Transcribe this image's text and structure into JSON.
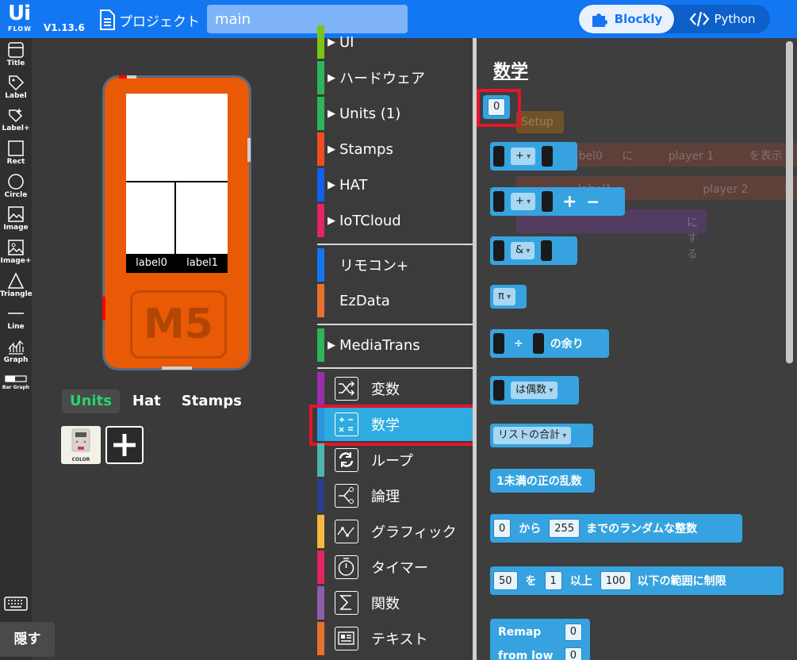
{
  "header": {
    "logo_text": "Ui",
    "logo_sub": "FLOW",
    "version": "V1.13.6",
    "project_label": "プロジェクト",
    "filename": "main",
    "mode_blockly": "Blockly",
    "mode_python": "Python"
  },
  "tools": [
    {
      "label": "Title",
      "icon": "title-icon"
    },
    {
      "label": "Label",
      "icon": "label-icon"
    },
    {
      "label": "Label+",
      "icon": "label-plus-icon"
    },
    {
      "label": "Rect",
      "icon": "rect-icon"
    },
    {
      "label": "Circle",
      "icon": "circle-icon"
    },
    {
      "label": "Image",
      "icon": "image-icon"
    },
    {
      "label": "Image+",
      "icon": "image-plus-icon"
    },
    {
      "label": "Triangle",
      "icon": "triangle-icon"
    },
    {
      "label": "Line",
      "icon": "line-icon"
    },
    {
      "label": "Graph",
      "icon": "graph-icon"
    },
    {
      "label": "Bar Graph",
      "icon": "bar-graph-icon"
    }
  ],
  "device": {
    "label0": "label0",
    "label1": "label1",
    "brand": "M5"
  },
  "unit_tabs": [
    "Units",
    "Hat",
    "Stamps"
  ],
  "unit_card_label": "COLOR",
  "hide_button": "隠す",
  "categories": [
    {
      "label": "UI",
      "color": "#7cc417",
      "expandable": true
    },
    {
      "label": "ハードウェア",
      "color": "#2eb557",
      "expandable": true
    },
    {
      "label": "Units (1)",
      "color": "#2eb557",
      "expandable": true
    },
    {
      "label": "Stamps",
      "color": "#f04e22",
      "expandable": true
    },
    {
      "label": "HAT",
      "color": "#1460f0",
      "expandable": true
    },
    {
      "label": "IoTCloud",
      "color": "#e2265f",
      "expandable": true
    },
    {
      "label": "リモコン+",
      "color": "#1477f2",
      "expandable": false
    },
    {
      "label": "EzData",
      "color": "#e8712e",
      "expandable": false
    },
    {
      "label": "MediaTrans",
      "color": "#2eb557",
      "expandable": true
    },
    {
      "label": "変数",
      "color": "#9b2fae",
      "icon": "shuffle-icon"
    },
    {
      "label": "数学",
      "color": "#2e94e0",
      "icon": "math-icon"
    },
    {
      "label": "ループ",
      "color": "#4db6ac",
      "icon": "loop-icon"
    },
    {
      "label": "論理",
      "color": "#2c3e8f",
      "icon": "logic-icon"
    },
    {
      "label": "グラフィック",
      "color": "#f6b93b",
      "icon": "graphic-icon"
    },
    {
      "label": "タイマー",
      "color": "#e2265f",
      "icon": "timer-icon"
    },
    {
      "label": "関数",
      "color": "#8e5dab",
      "icon": "sigma-icon"
    },
    {
      "label": "テキスト",
      "color": "#e8712e",
      "icon": "text-icon"
    }
  ],
  "flyout": {
    "title": "数学",
    "number_block": "0",
    "op_plus": "+",
    "op_and": "&",
    "pi": "π",
    "mod_op": "÷",
    "mod_label": "の余り",
    "even": "は偶数",
    "list_sum": "リストの合計",
    "random_frac": "1未満の正の乱数",
    "rand_from": "0",
    "rand_kara": "から",
    "rand_to": "255",
    "rand_label": "までのランダムな整数",
    "clamp_val": "50",
    "clamp_wo": "を",
    "clamp_min": "1",
    "clamp_ijou": "以上",
    "clamp_max": "100",
    "clamp_label": "以下の範囲に制限",
    "remap": "Remap",
    "remap_val": "0",
    "from_low": "from low",
    "from_low_val": "0",
    "plus_sign": "+",
    "minus_sign": "−"
  },
  "ghost": {
    "setup": "Setup",
    "label0": "abel0",
    "ni": "に",
    "player1": "player 1",
    "hyouji": "を表示",
    "label1": "label1",
    "player2": "player 2",
    "suru": "にする"
  }
}
